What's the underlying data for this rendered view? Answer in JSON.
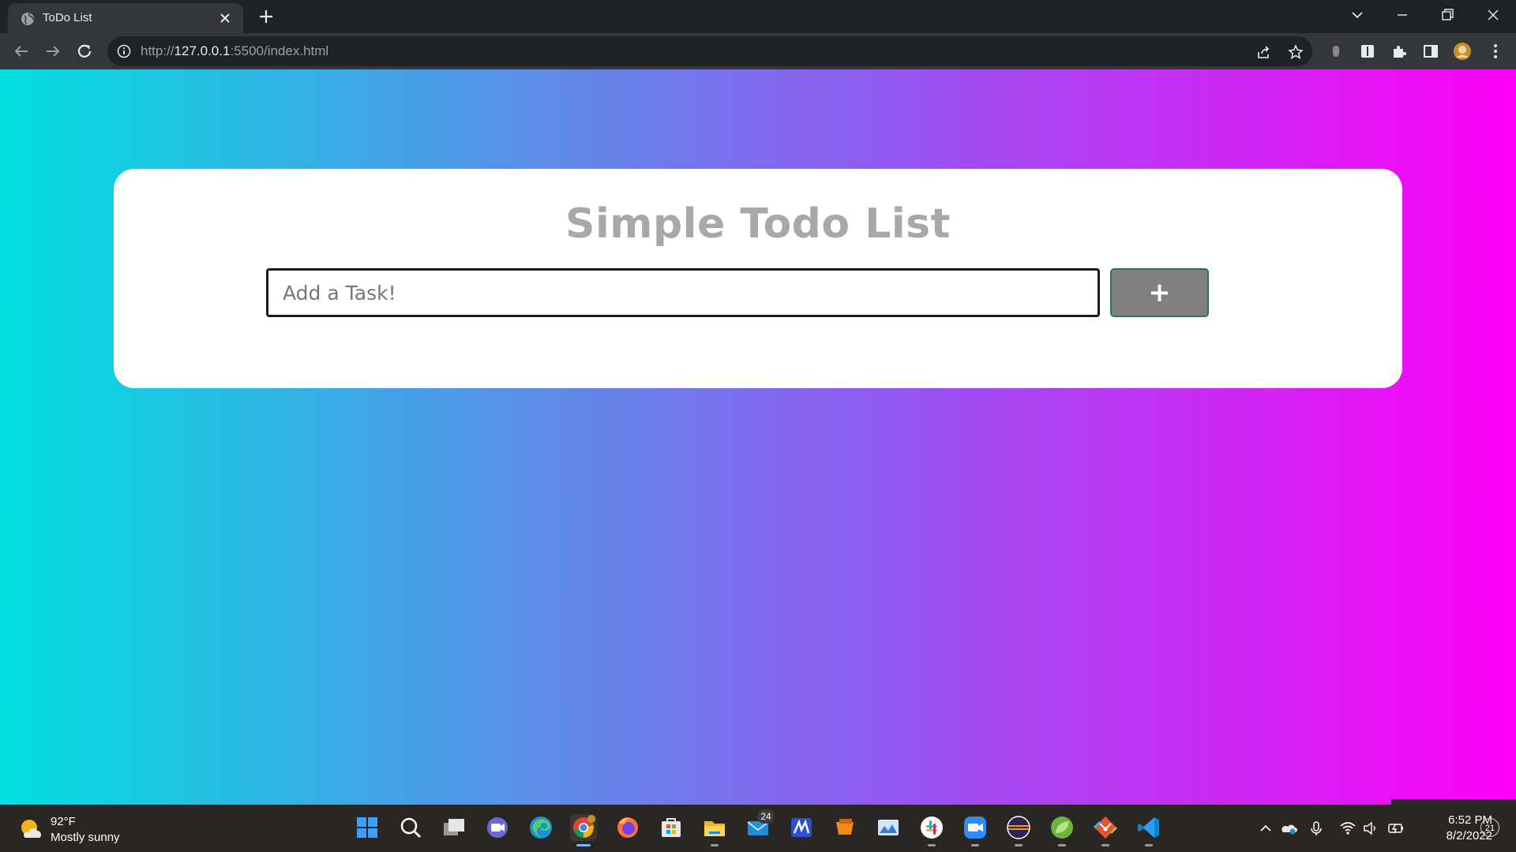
{
  "browser": {
    "tab_title": "ToDo List",
    "url_scheme": "http://",
    "url_host": "127.0.0.1",
    "url_rest": ":5500/index.html"
  },
  "page": {
    "heading": "Simple Todo List",
    "input_placeholder": "Add a Task!",
    "input_value": "",
    "add_button_label": "+"
  },
  "taskbar": {
    "weather_temp": "92°F",
    "weather_condition": "Mostly sunny",
    "mail_badge": "24",
    "time": "6:52 PM",
    "date": "8/2/2022",
    "notification_count": "21",
    "apps": [
      "start",
      "search",
      "task-view",
      "teams-chat",
      "edge",
      "chrome",
      "firefox",
      "store",
      "file-explorer",
      "mail",
      "app-m",
      "app-orange",
      "photos",
      "slack",
      "zoom",
      "eclipse",
      "spring",
      "git",
      "vscode"
    ]
  },
  "colors": {
    "gradient_start": "#00dfe0",
    "gradient_end": "#ff00f7",
    "heading": "#a8a8a8",
    "button": "#808080"
  }
}
